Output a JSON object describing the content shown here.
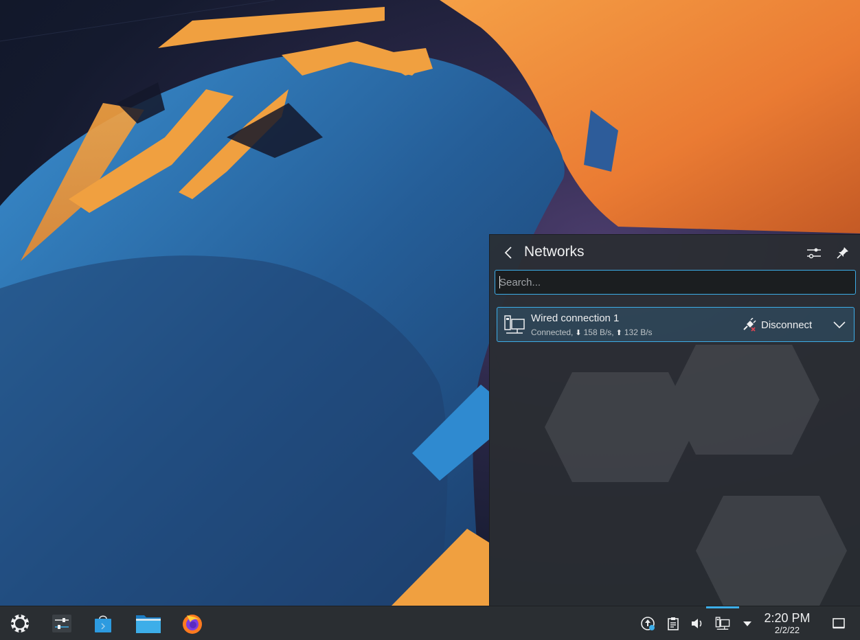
{
  "popup": {
    "title": "Networks",
    "back_icon": "chevron-left-icon",
    "config_icon": "configure-icon",
    "pin_icon": "pin-icon",
    "search": {
      "placeholder": "Search...",
      "value": ""
    },
    "connections": [
      {
        "name": "Wired connection 1",
        "status_prefix": "Connected,",
        "download": "158 B/s,",
        "upload": "132 B/s",
        "icon": "wired-network-icon",
        "action_label": "Disconnect",
        "action_icon": "disconnect-plug-icon",
        "expand_icon": "chevron-down-icon"
      }
    ]
  },
  "taskbar": {
    "launchers": [
      {
        "name": "application-launcher",
        "icon": "kde-launcher-icon"
      },
      {
        "name": "system-settings",
        "icon": "settings-sliders-icon"
      },
      {
        "name": "discover",
        "icon": "store-bag-icon"
      },
      {
        "name": "file-manager",
        "icon": "folder-icon"
      },
      {
        "name": "firefox",
        "icon": "firefox-icon"
      }
    ],
    "tray": [
      {
        "name": "updates",
        "icon": "update-arrow-icon"
      },
      {
        "name": "clipboard",
        "icon": "clipboard-icon"
      },
      {
        "name": "volume",
        "icon": "speaker-icon"
      },
      {
        "name": "network",
        "icon": "wired-network-icon",
        "active": true
      },
      {
        "name": "expand-tray",
        "icon": "triangle-down-icon"
      }
    ],
    "clock": {
      "time": "2:20 PM",
      "date": "2/2/22"
    },
    "show_desktop_icon": "show-desktop-icon"
  },
  "colors": {
    "accent": "#3daee9",
    "panel": "#2a2e32",
    "text": "#eff0f1",
    "wallpaper_orange": "#f0883a",
    "wallpaper_blue": "#2d79b8"
  }
}
